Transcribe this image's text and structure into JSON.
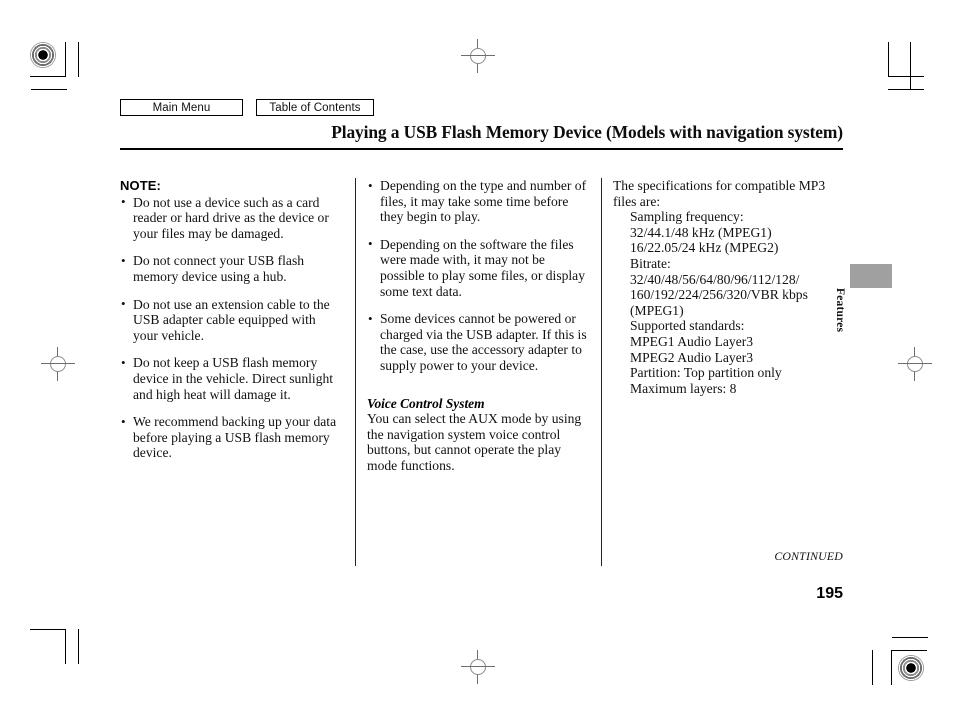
{
  "nav": {
    "main_menu": "Main Menu",
    "table_of_contents": "Table of Contents"
  },
  "header": {
    "title": "Playing a USB Flash Memory Device (Models with navigation system)"
  },
  "columns": {
    "left": {
      "note_heading": "NOTE:",
      "bullets": [
        "Do not use a device such as a card reader or hard drive as the device or your files may be damaged.",
        "Do not connect your USB flash memory device using a hub.",
        "Do not use an extension cable to the USB adapter cable equipped with your vehicle.",
        "Do not keep a USB flash memory device in the vehicle. Direct sunlight and high heat will damage it.",
        "We recommend backing up your data before playing a USB flash memory device."
      ]
    },
    "middle": {
      "bullets": [
        "Depending on the type and number of files, it may take some time before they begin to play.",
        "Depending on the software the files were made with, it may not be possible to play some files, or display some text data.",
        "Some devices cannot be powered or charged via the USB adapter. If this is the case, use the accessory adapter to supply power to your device."
      ],
      "subhead": "Voice Control System",
      "paragraph": "You can select the AUX mode by using the navigation system voice control buttons, but cannot operate the play mode functions."
    },
    "right": {
      "intro": "The specifications for compatible MP3 files are:",
      "spec_lines": [
        "Sampling frequency:",
        "32/44.1/48 kHz (MPEG1)",
        "16/22.05/24 kHz (MPEG2)",
        "Bitrate:",
        "32/40/48/56/64/80/96/112/128/",
        "160/192/224/256/320/VBR kbps",
        "(MPEG1)",
        "Supported standards:",
        "MPEG1 Audio Layer3",
        "MPEG2 Audio Layer3",
        "Partition: Top partition only",
        "Maximum layers: 8"
      ]
    }
  },
  "side_tab": {
    "label": "Features",
    "marker_color": "#a0a0a0"
  },
  "footer": {
    "continued": "CONTINUED",
    "page_number": "195"
  }
}
